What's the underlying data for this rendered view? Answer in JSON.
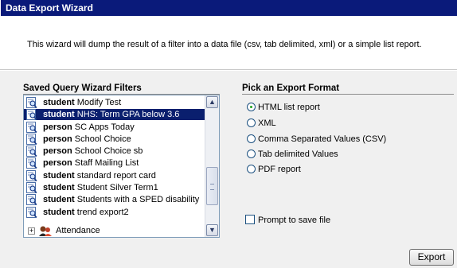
{
  "window": {
    "title": "Data Export Wizard"
  },
  "description": "This wizard will dump the result of a filter into a data file (csv, tab delimited, xml) or a simple list report.",
  "filters": {
    "header": "Saved Query Wizard Filters",
    "items": [
      {
        "kind": "student",
        "name": "Modify Test",
        "selected": false
      },
      {
        "kind": "student",
        "name": "NHS: Term GPA below 3.6",
        "selected": true
      },
      {
        "kind": "person",
        "name": "SC Apps Today",
        "selected": false
      },
      {
        "kind": "person",
        "name": "School Choice",
        "selected": false
      },
      {
        "kind": "person",
        "name": "School Choice sb",
        "selected": false
      },
      {
        "kind": "person",
        "name": "Staff Mailing List",
        "selected": false
      },
      {
        "kind": "student",
        "name": "standard report card",
        "selected": false
      },
      {
        "kind": "student",
        "name": "Student Silver Term1",
        "selected": false
      },
      {
        "kind": "student",
        "name": "Students with a SPED disability",
        "selected": false
      },
      {
        "kind": "student",
        "name": "trend export2",
        "selected": false
      }
    ],
    "group": {
      "expander": "+",
      "label": "Attendance"
    }
  },
  "formats": {
    "header": "Pick an Export Format",
    "options": [
      {
        "label": "HTML list report",
        "checked": true
      },
      {
        "label": "XML",
        "checked": false
      },
      {
        "label": "Comma Separated Values (CSV)",
        "checked": false
      },
      {
        "label": "Tab delimited Values",
        "checked": false
      },
      {
        "label": "PDF report",
        "checked": false
      }
    ]
  },
  "prompt_save": {
    "label": "Prompt to save file",
    "checked": false
  },
  "export_button": {
    "label": "Export"
  },
  "icons": {
    "query": "query-magnifier-icon",
    "group": "attendance-group-icon",
    "scroll_up": "scroll-up-icon",
    "scroll_down": "scroll-down-icon"
  }
}
